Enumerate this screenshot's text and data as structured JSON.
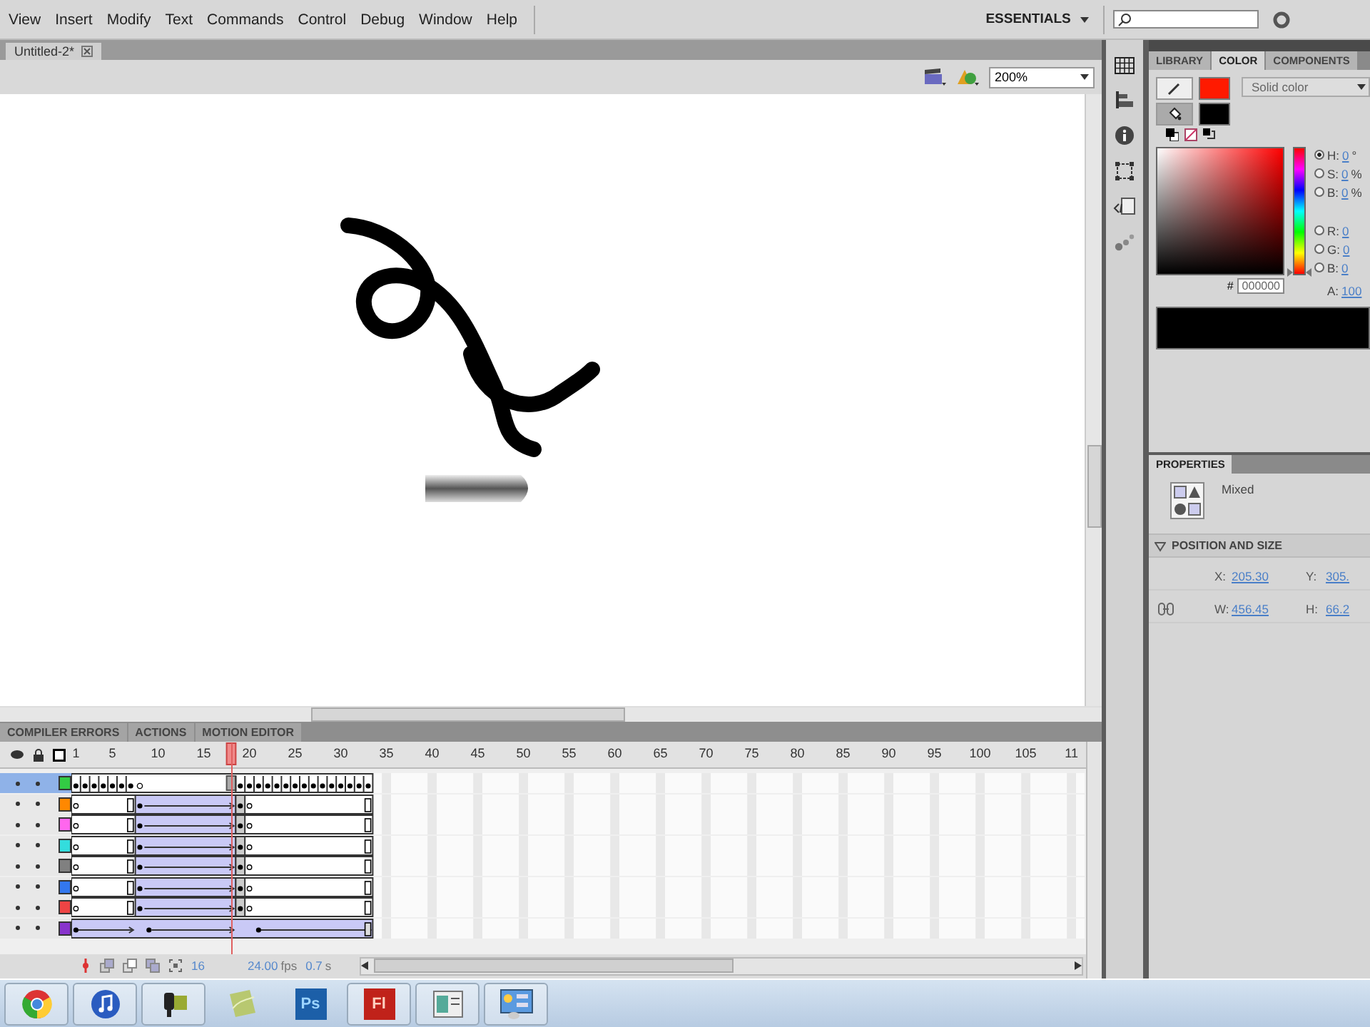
{
  "menu": [
    "View",
    "Insert",
    "Modify",
    "Text",
    "Commands",
    "Control",
    "Debug",
    "Window",
    "Help"
  ],
  "workspace": "ESSENTIALS",
  "document_tabs": [
    {
      "label": "Untitled-2*",
      "selected": true
    }
  ],
  "zoom": "200%",
  "panel_tabs": [
    {
      "label": "LIBRARY",
      "selected": false
    },
    {
      "label": "COLOR",
      "selected": true
    },
    {
      "label": "COMPONENTS",
      "selected": false
    }
  ],
  "color": {
    "swatches": [
      {
        "kind": "stroke",
        "color": "#ff1a00"
      },
      {
        "kind": "fill",
        "color": "#000000"
      }
    ],
    "fill_type": "Solid color",
    "channels": [
      {
        "label": "H:",
        "value": "0",
        "unit": "°",
        "selected": true
      },
      {
        "label": "S:",
        "value": "0",
        "unit": "%",
        "selected": false
      },
      {
        "label": "B:",
        "value": "0",
        "unit": "%",
        "selected": false
      },
      {
        "label": "R:",
        "value": "0",
        "selected": false
      },
      {
        "label": "G:",
        "value": "0",
        "selected": false
      },
      {
        "label": "B:",
        "value": "0",
        "selected": false
      }
    ],
    "hue_slider": {
      "level": 0
    },
    "hex_prefix": "#",
    "hex": "000000",
    "alpha_label": "A:",
    "alpha": "100"
  },
  "properties": {
    "tab": "PROPERTIES",
    "selection": "Mixed",
    "section": "POSITION AND SIZE",
    "expanded": true,
    "fields": [
      {
        "label": "X:",
        "value": "205.30"
      },
      {
        "label": "Y:",
        "value": "305."
      },
      {
        "label": "W:",
        "value": "456.45"
      },
      {
        "label": "H:",
        "value": "66.2"
      }
    ]
  },
  "timeline": {
    "tabs": [
      "COMPILER ERRORS",
      "ACTIONS",
      "MOTION EDITOR"
    ],
    "frame_numbers": [
      "1",
      "5",
      "10",
      "15",
      "20",
      "25",
      "30",
      "35",
      "40",
      "45",
      "50",
      "55",
      "60",
      "65",
      "70",
      "75",
      "80",
      "85",
      "90",
      "95",
      "100",
      "105",
      "11"
    ],
    "layers": [
      {
        "color": "#33cc44",
        "selected": true,
        "kind": "keyframes"
      },
      {
        "color": "#ff8800",
        "selected": false,
        "kind": "tween"
      },
      {
        "color": "#ff66ee",
        "selected": false,
        "kind": "tween"
      },
      {
        "color": "#33dddd",
        "selected": false,
        "kind": "tween"
      },
      {
        "color": "#808080",
        "selected": false,
        "kind": "tween"
      },
      {
        "color": "#3377ee",
        "selected": false,
        "kind": "tween"
      },
      {
        "color": "#ee4444",
        "selected": false,
        "kind": "tween"
      },
      {
        "color": "#8833cc",
        "selected": false,
        "kind": "full-tween"
      }
    ],
    "current_frame": "16",
    "fps": "24.00",
    "fps_unit": "fps",
    "time": "0.7",
    "time_unit": "s"
  },
  "taskbar": [
    {
      "kind": "browser",
      "running": true
    },
    {
      "kind": "music",
      "running": true
    },
    {
      "kind": "camera",
      "running": true
    },
    {
      "kind": "leaf",
      "running": false
    },
    {
      "kind": "ps",
      "label": "Ps",
      "running": false
    },
    {
      "kind": "fl",
      "label": "Fl",
      "running": true
    },
    {
      "kind": "window",
      "running": true
    },
    {
      "kind": "control-panel",
      "running": true
    }
  ]
}
